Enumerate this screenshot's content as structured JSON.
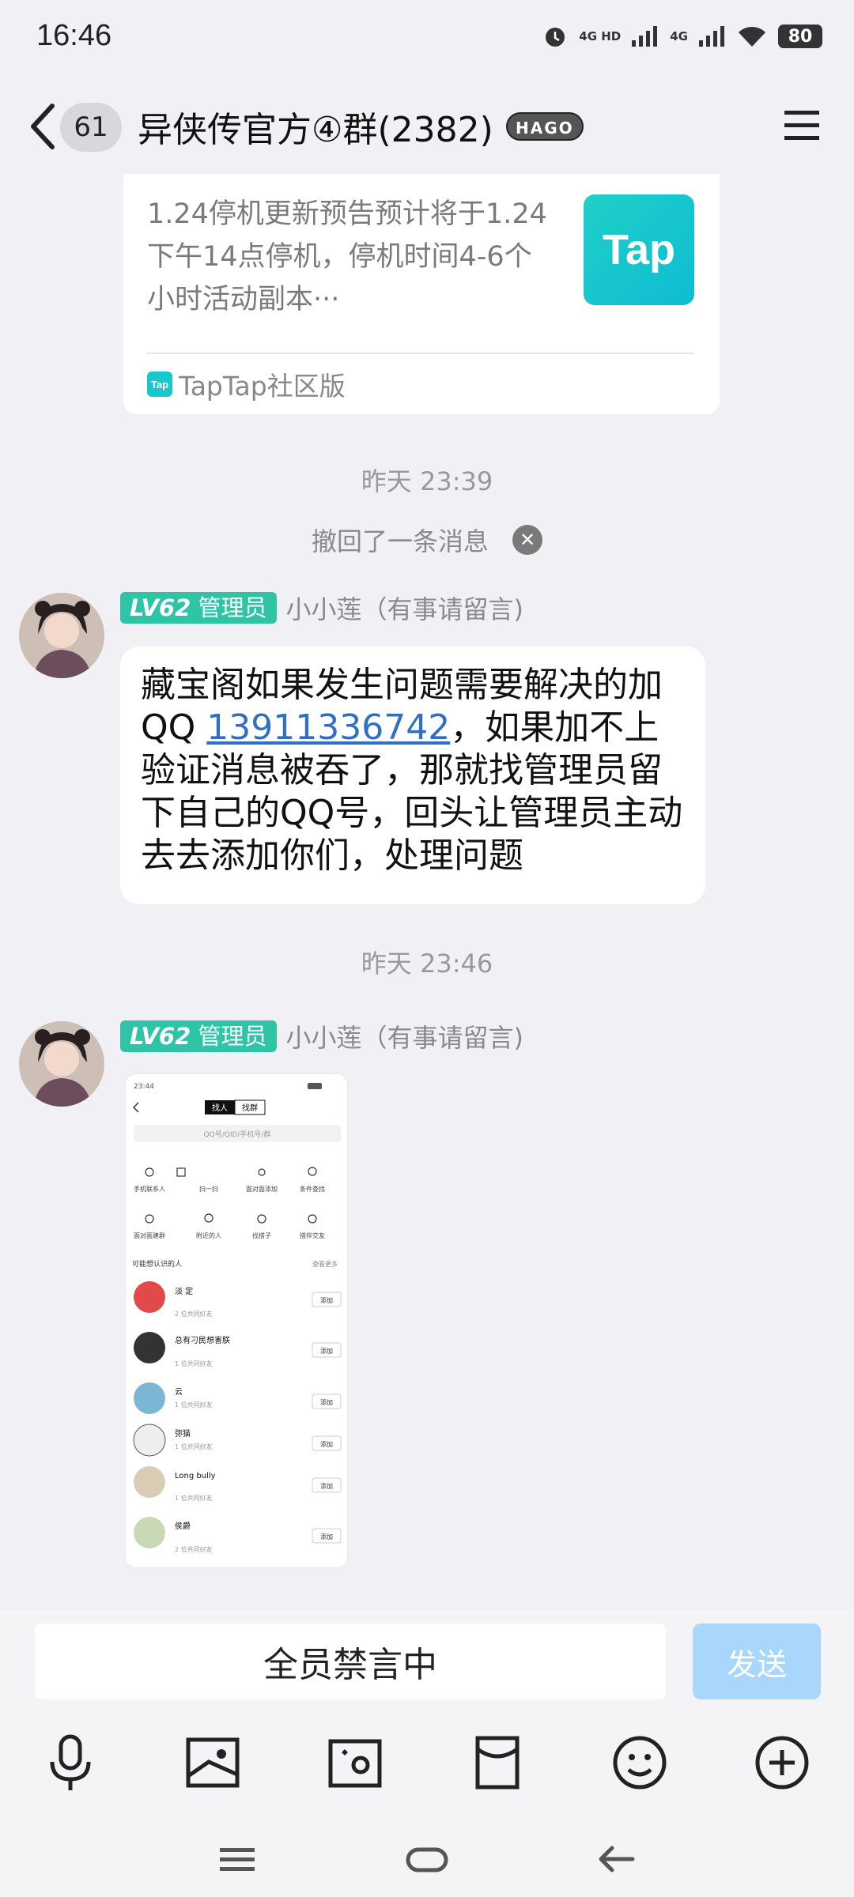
{
  "status_bar": {
    "time": "16:46",
    "network1": "4G HD",
    "network2": "4G",
    "battery": "80",
    "icons": [
      "alarm-icon",
      "signal-icon",
      "wifi-icon",
      "battery-icon"
    ]
  },
  "header": {
    "unread_count": "61",
    "title": "异侠传官方④群(2382)",
    "badge": "HAGO",
    "icons": [
      "back-arrow-icon",
      "menu-icon"
    ]
  },
  "shared_card": {
    "excerpt": "1.24停机更新预告预计将于1.24下午14点停机，停机时间4-6个小时活动副本···",
    "logo_text": "Tap",
    "source": "TapTap社区版"
  },
  "messages": {
    "timestamp1": "昨天 23:39",
    "recall_notice": "撤回了一条消息",
    "level_badge": "LV62",
    "role": "管理员",
    "sender": "小小莲（有事请留言)",
    "text_before": "藏宝阁如果发生问题需要解决的加QQ ",
    "qq_number": "13911336742",
    "text_after": "，如果加不上验证消息被吞了，那就找管理员留下自己的QQ号，回头让管理员主动去去添加你们，处理问题",
    "timestamp2": "昨天 23:46"
  },
  "screenshot": {
    "time": "23:44",
    "tab_find_people": "找人",
    "tab_find_group": "找群",
    "search_placeholder": "QQ号/QID/手机号/群",
    "actions": [
      "手机联系人",
      "扫一扫",
      "面对面添加",
      "条件查找",
      "面对面建群",
      "附近的人",
      "找搭子",
      "搭伴交友"
    ],
    "suggest_header": "可能想认识的人",
    "see_more": "查看更多",
    "add_label": "添加",
    "contacts": [
      {
        "name": "淡 定",
        "mutual": "2 位共同好友"
      },
      {
        "name": "总有刁民想害朕",
        "mutual": "1 位共同好友"
      },
      {
        "name": "云",
        "mutual": "1 位共同好友"
      },
      {
        "name": "弥猫",
        "mutual": "1 位共同好友"
      },
      {
        "name": "Long bully",
        "mutual": "1 位共同好友"
      },
      {
        "name": "侯爵",
        "mutual": "2 位共同好友"
      }
    ]
  },
  "composer": {
    "mute_text": "全员禁言中",
    "send_label": "发送",
    "tools": [
      "microphone-icon",
      "image-icon",
      "camera-icon",
      "red-packet-icon",
      "emoji-icon",
      "plus-icon"
    ]
  }
}
